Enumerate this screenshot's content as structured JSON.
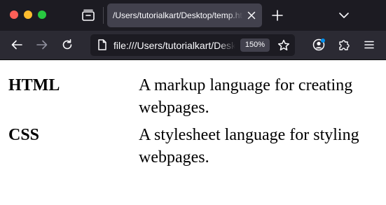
{
  "browser": {
    "tab": {
      "title": "/Users/tutorialkart/Desktop/temp.html"
    },
    "url": "file:///Users/tutorialkart/Desktop/temp.html",
    "zoom": "150%",
    "colors": {
      "titlebar": "#1c1b22",
      "toolbar": "#2b2a33",
      "active_tab": "#42414d",
      "urlbar": "#1c1b22",
      "account_badge": "#0090ed"
    },
    "icons": [
      "tab-manager-icon",
      "close-icon",
      "plus-icon",
      "chevron-down-icon",
      "back-arrow-icon",
      "forward-arrow-icon",
      "reload-icon",
      "page-icon",
      "star-icon",
      "account-icon",
      "extensions-icon",
      "hamburger-menu-icon"
    ]
  },
  "page": {
    "definitions": [
      {
        "term": "HTML",
        "description": "A markup language for creating webpages."
      },
      {
        "term": "CSS",
        "description": "A stylesheet language for styling webpages."
      }
    ]
  }
}
